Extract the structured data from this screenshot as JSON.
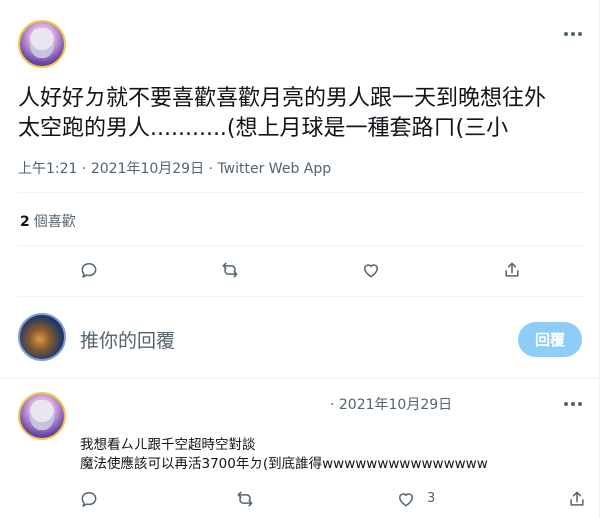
{
  "tweet": {
    "text_line1": "人好好ㄉ就不要喜歡喜歡月亮的男人跟一天到晚想往外",
    "text_line2": "太空跑的男人...........(想上月球是一種套路ㄇ(三小",
    "time": "上午1:21",
    "date": "2021年10月29日",
    "client": "Twitter Web App",
    "likes_count": "2",
    "likes_label": "個喜歡"
  },
  "compose": {
    "placeholder": "推你的回覆",
    "button_label": "回覆"
  },
  "reply": {
    "date": "· 2021年10月29日",
    "line1": "我想看ㄙㄦ跟千空超時空對談",
    "line2": "魔法使應該可以再活3700年ㄉ(到底誰得wwwwwwwwwwwwwww",
    "like_count": "3"
  },
  "icons": {
    "reply": "comment-icon",
    "retweet": "retweet-icon",
    "like": "heart-icon",
    "share": "share-icon",
    "more": "more-icon"
  },
  "colors": {
    "accent_button": "#8ecdf8",
    "secondary_text": "#536471",
    "text": "#0f1419"
  }
}
